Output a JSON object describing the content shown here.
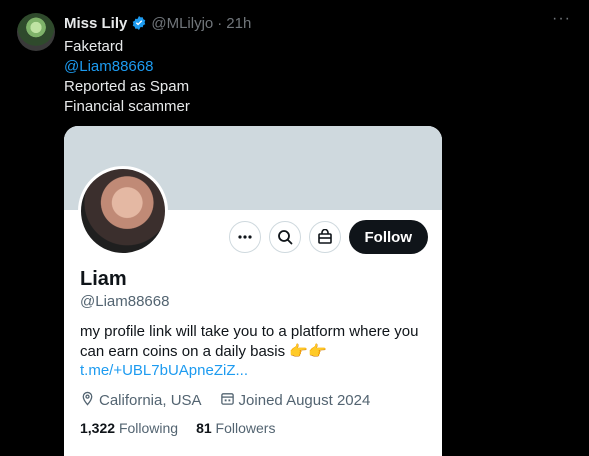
{
  "tweet": {
    "author_name": "Miss Lily",
    "author_handle": "@MLilyjo",
    "separator": "·",
    "time": "21h",
    "lines": [
      "Faketard",
      "@Liam88668",
      "Reported as Spam",
      "Financial scammer"
    ]
  },
  "card": {
    "name": "Liam",
    "handle": "@Liam88668",
    "bio": "my profile link will take you to a platform where you can earn coins on a daily basis 👉👉",
    "link": "t.me/+UBL7bUApneZiZ...",
    "location": "California, USA",
    "joined": "Joined August 2024",
    "following_count": "1,322",
    "following_label": "Following",
    "followers_count": "81",
    "followers_label": "Followers",
    "follow_button": "Follow"
  },
  "icons": {
    "verified": "verified-badge-icon",
    "more": "more-icon",
    "location": "location-icon",
    "calendar": "calendar-icon",
    "search": "search-icon",
    "shop": "shop-icon"
  },
  "colors": {
    "accent": "#1d9bf0",
    "background": "#000000",
    "card_background": "#ffffff",
    "muted": "#71767b"
  }
}
